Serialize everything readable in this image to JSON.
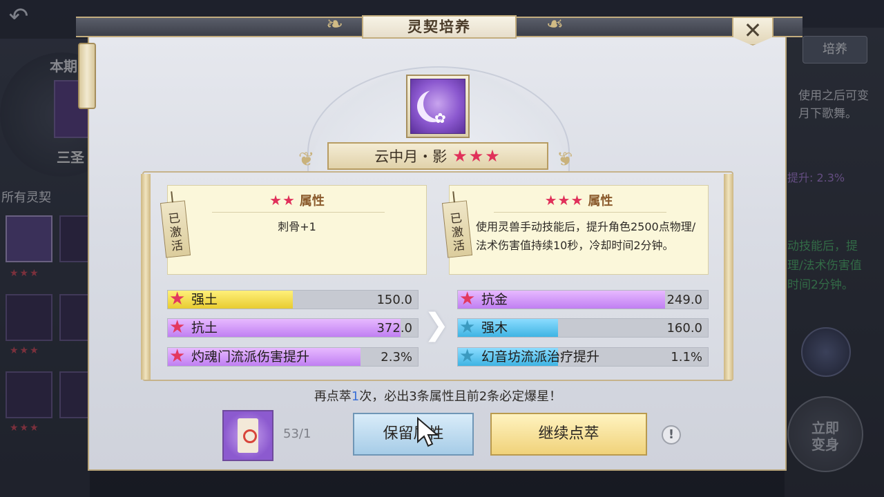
{
  "background": {
    "left_title": "本期",
    "left_name": "三圣",
    "all_label": "所有灵契",
    "right_tab": "培养",
    "right_desc_1": "使用之后可变",
    "right_desc_2": "月下歌舞。",
    "right_boost": "提升: 2.3%",
    "right_effect_1": "动技能后，提",
    "right_effect_2": "理/法术伤害值",
    "right_effect_3": "时间2分钟。",
    "transform_btn_1": "立即",
    "transform_btn_2": "变身"
  },
  "dialog": {
    "title": "灵契培养",
    "close_label": "✕",
    "item_name": "云中月・影",
    "item_stars": "★★★",
    "current": {
      "stars": "★★",
      "label": "属性",
      "tag": "已激活",
      "effect": "刺骨+1"
    },
    "next": {
      "stars": "★★★",
      "label": "属性",
      "tag": "已激活",
      "effect": "使用灵兽手动技能后，提升角色2500点物理/法术伤害值持续10秒，冷却时间2分钟。"
    },
    "current_stats": [
      {
        "name": "强土",
        "value": "150.0",
        "fill": 0.5
      },
      {
        "name": "抗土",
        "value": "372.0",
        "fill": 0.93
      },
      {
        "name": "灼魂门流派伤害提升",
        "value": "2.3%",
        "fill": 0.77
      }
    ],
    "next_stats": [
      {
        "name": "抗金",
        "value": "249.0",
        "fill": 0.83
      },
      {
        "name": "强木",
        "value": "160.0",
        "fill": 0.4
      },
      {
        "name": "幻音坊流派治疗提升",
        "value": "1.1%",
        "fill": 0.4
      }
    ],
    "hint_prefix": "再点萃",
    "hint_num": "1",
    "hint_suffix": "次，必出3条属性且前2条必定爆星！",
    "cost_count": "53/1",
    "keep_button": "保留属性",
    "continue_button": "继续点萃",
    "info_icon": "!"
  }
}
